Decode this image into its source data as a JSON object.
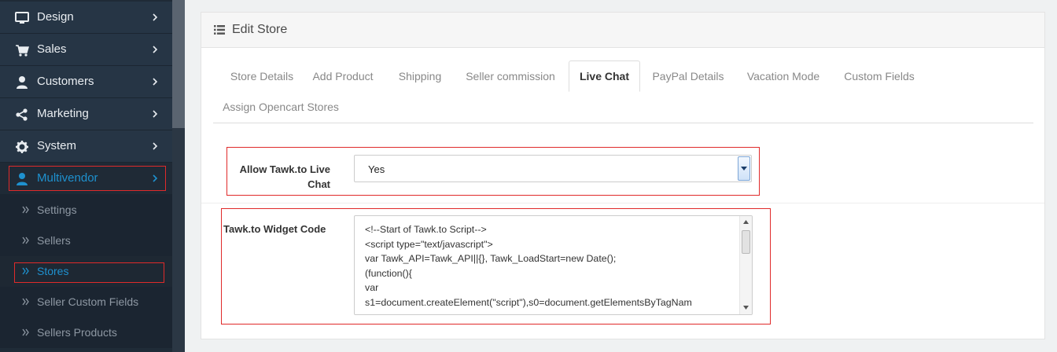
{
  "sidebar": {
    "items": [
      {
        "label": "Design",
        "icon": "desktop-icon"
      },
      {
        "label": "Sales",
        "icon": "shopping-cart-icon"
      },
      {
        "label": "Customers",
        "icon": "user-icon"
      },
      {
        "label": "Marketing",
        "icon": "share-icon"
      },
      {
        "label": "System",
        "icon": "gear-icon"
      },
      {
        "label": "Multivendor",
        "icon": "user-icon"
      }
    ],
    "sub_items": [
      {
        "label": "Settings"
      },
      {
        "label": "Sellers"
      },
      {
        "label": "Stores"
      },
      {
        "label": "Seller Custom Fields"
      },
      {
        "label": "Sellers Products"
      }
    ]
  },
  "panel": {
    "title": "Edit Store",
    "title_icon": "list-icon"
  },
  "tabs": [
    {
      "label": "Store Details"
    },
    {
      "label": "Add Product"
    },
    {
      "label": "Shipping"
    },
    {
      "label": "Seller commission"
    },
    {
      "label": "Live Chat",
      "active": true
    },
    {
      "label": "PayPal Details"
    },
    {
      "label": "Vacation Mode"
    },
    {
      "label": "Custom Fields"
    },
    {
      "label": "Assign Opencart Stores"
    }
  ],
  "form": {
    "live_chat_label_line1": "Allow Tawk.to Live",
    "live_chat_label_line2": "Chat",
    "live_chat_value": "Yes",
    "widget_label": "Tawk.to Widget Code",
    "widget_code": "<!--Start of Tawk.to Script-->\n<script type=\"text/javascript\">\nvar Tawk_API=Tawk_API||{}, Tawk_LoadStart=new Date();\n(function(){\nvar\ns1=document.createElement(\"script\"),s0=document.getElementsByTagNam"
  },
  "colors": {
    "accent": "#1e91cf",
    "highlight": "#e02a2a",
    "sidebar_bg": "#263545"
  }
}
